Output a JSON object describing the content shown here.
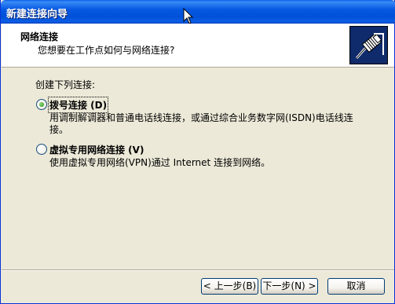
{
  "window": {
    "title": "新建连接向导"
  },
  "header": {
    "title": "网络连接",
    "subtitle": "您想要在工作点如何与网络连接?",
    "icon": "network-plug-icon"
  },
  "content": {
    "section_label": "创建下列连接:",
    "options": [
      {
        "label": "拨号连接 (D)",
        "selected": true,
        "description": "用调制解调器和普通电话线连接，或通过综合业务数字网(ISDN)电话线连接。"
      },
      {
        "label": "虚拟专用网络连接 (V)",
        "selected": false,
        "description": "使用虚拟专用网络(VPN)通过 Internet 连接到网络。"
      }
    ]
  },
  "buttons": {
    "back": "< 上一步(B)",
    "next": "下一步(N) >",
    "cancel": "取消"
  }
}
